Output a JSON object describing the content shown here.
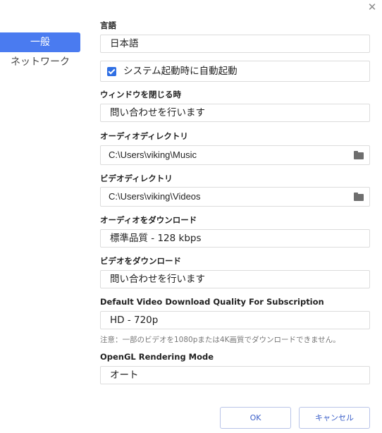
{
  "window": {
    "close_glyph": "✕"
  },
  "sidebar": {
    "items": [
      {
        "label": "一般",
        "active": true
      },
      {
        "label": "ネットワーク",
        "active": false
      }
    ]
  },
  "settings": {
    "language": {
      "label": "言語",
      "value": "日本語"
    },
    "autostart": {
      "label": "システム起動時に自動起動",
      "checked": true
    },
    "on_close": {
      "label": "ウィンドウを閉じる時",
      "value": "問い合わせを行います"
    },
    "audio_dir": {
      "label": "オーディオディレクトリ",
      "value": "C:\\Users\\viking\\Music",
      "icon": "folder-icon"
    },
    "video_dir": {
      "label": "ビデオディレクトリ",
      "value": "C:\\Users\\viking\\Videos",
      "icon": "folder-icon"
    },
    "audio_download": {
      "label": "オーディオをダウンロード",
      "value": "標準品質 - 128 kbps"
    },
    "video_download": {
      "label": "ビデオをダウンロード",
      "value": "問い合わせを行います"
    },
    "subscription_quality": {
      "label": "Default Video Download Quality For Subscription",
      "value": "HD - 720p"
    },
    "note": "注意：一部のビデオを1080pまたは4K画質でダウンロードできません。",
    "opengl": {
      "label": "OpenGL Rendering Mode",
      "value": "オート"
    }
  },
  "footer": {
    "ok_label": "OK",
    "cancel_label": "キャンセル"
  },
  "colors": {
    "accent": "#4a7bf0",
    "checkbox": "#2f6fe4",
    "button_text": "#3b5fc9"
  }
}
